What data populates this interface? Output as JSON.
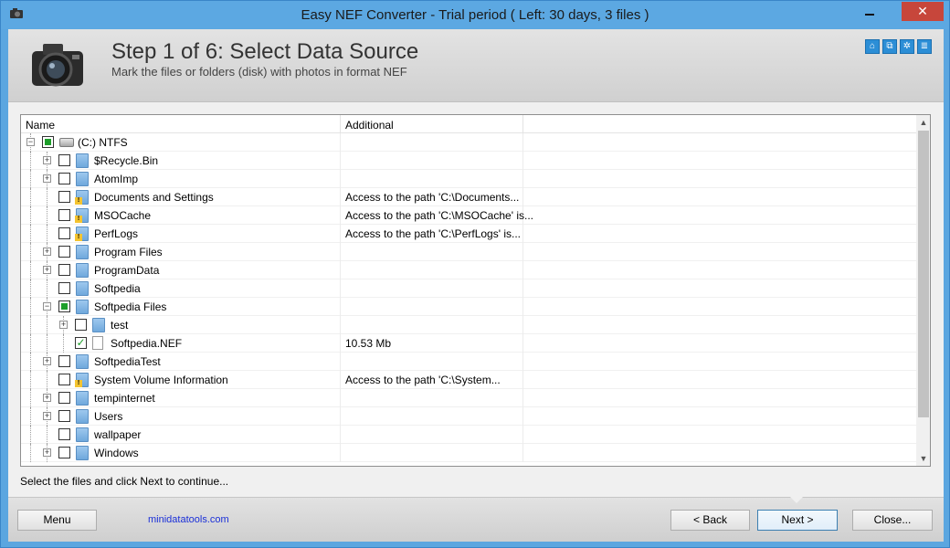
{
  "window": {
    "title": "Easy NEF Converter - Trial period ( Left: 30 days, 3 files )",
    "close_glyph": "✕"
  },
  "header": {
    "title": "Step 1 of 6: Select Data Source",
    "subtitle": "Mark the files or folders (disk) with photos in format NEF",
    "icons": [
      "home-icon",
      "network-icon",
      "settings-icon",
      "document-icon"
    ]
  },
  "tree": {
    "columns": [
      "Name",
      "Additional"
    ],
    "rows": [
      {
        "label": "(C:) NTFS",
        "additional": "",
        "level": 0,
        "expander": "−",
        "check": "partial",
        "icon": "drive"
      },
      {
        "label": "$Recycle.Bin",
        "additional": "",
        "level": 1,
        "expander": "+",
        "check": "unchecked",
        "icon": "folder"
      },
      {
        "label": "AtomImp",
        "additional": "",
        "level": 1,
        "expander": "+",
        "check": "unchecked",
        "icon": "folder"
      },
      {
        "label": "Documents and Settings",
        "additional": "Access to the path 'C:\\Documents...",
        "level": 1,
        "expander": "",
        "check": "unchecked",
        "icon": "folder-locked"
      },
      {
        "label": "MSOCache",
        "additional": "Access to the path 'C:\\MSOCache' is...",
        "level": 1,
        "expander": "",
        "check": "unchecked",
        "icon": "folder-locked"
      },
      {
        "label": "PerfLogs",
        "additional": "Access to the path 'C:\\PerfLogs' is...",
        "level": 1,
        "expander": "",
        "check": "unchecked",
        "icon": "folder-locked"
      },
      {
        "label": "Program Files",
        "additional": "",
        "level": 1,
        "expander": "+",
        "check": "unchecked",
        "icon": "folder"
      },
      {
        "label": "ProgramData",
        "additional": "",
        "level": 1,
        "expander": "+",
        "check": "unchecked",
        "icon": "folder"
      },
      {
        "label": "Softpedia",
        "additional": "",
        "level": 1,
        "expander": "",
        "check": "unchecked",
        "icon": "folder"
      },
      {
        "label": "Softpedia Files",
        "additional": "",
        "level": 1,
        "expander": "−",
        "check": "partial",
        "icon": "folder"
      },
      {
        "label": "test",
        "additional": "",
        "level": 2,
        "expander": "+",
        "check": "unchecked",
        "icon": "folder"
      },
      {
        "label": "Softpedia.NEF",
        "additional": "10.53 Mb",
        "level": 2,
        "expander": "",
        "check": "checked",
        "icon": "file"
      },
      {
        "label": "SoftpediaTest",
        "additional": "",
        "level": 1,
        "expander": "+",
        "check": "unchecked",
        "icon": "folder"
      },
      {
        "label": "System Volume Information",
        "additional": "Access to the path 'C:\\System...",
        "level": 1,
        "expander": "",
        "check": "unchecked",
        "icon": "folder-locked"
      },
      {
        "label": "tempinternet",
        "additional": "",
        "level": 1,
        "expander": "+",
        "check": "unchecked",
        "icon": "folder"
      },
      {
        "label": "Users",
        "additional": "",
        "level": 1,
        "expander": "+",
        "check": "unchecked",
        "icon": "folder"
      },
      {
        "label": "wallpaper",
        "additional": "",
        "level": 1,
        "expander": "",
        "check": "unchecked",
        "icon": "folder"
      },
      {
        "label": "Windows",
        "additional": "",
        "level": 1,
        "expander": "+",
        "check": "unchecked",
        "icon": "folder"
      }
    ]
  },
  "status": "Select the files and click Next to continue...",
  "footer": {
    "menu_label": "Menu",
    "link_text": "minidatatools.com",
    "back_label": "< Back",
    "next_label": "Next >",
    "close_label": "Close..."
  },
  "colors": {
    "titlebar": "#5ca8e2",
    "close": "#c7463b",
    "check_green": "#1e9e2a",
    "link": "#1a2fd8"
  }
}
